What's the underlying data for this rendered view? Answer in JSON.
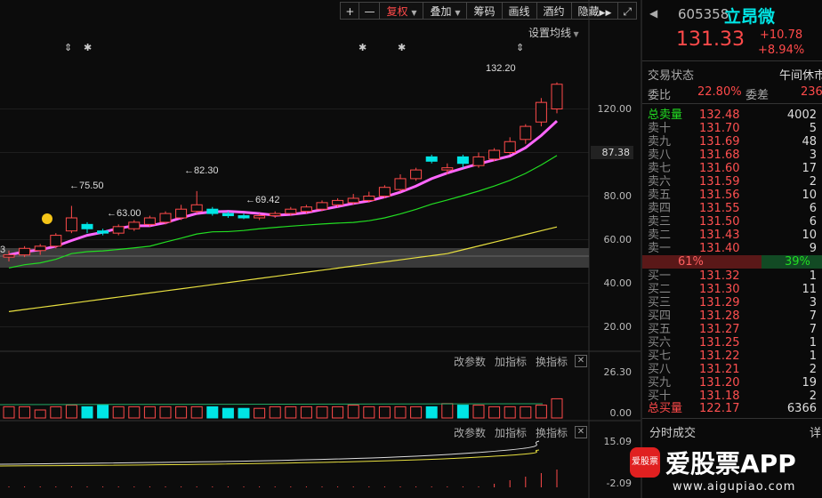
{
  "toolbar": {
    "plus": "+",
    "minus": "—",
    "restore": "复权",
    "overlay": "叠加",
    "chips": "筹码",
    "draw": "画线",
    "review": "酒约",
    "hide": "隐藏",
    "fullscreen_icon": "fullscreen-icon"
  },
  "chart": {
    "set_ma": "设置均线",
    "axis_labels": [
      "120.00",
      "100.00",
      "80.00",
      "60.00",
      "40.00",
      "20.00"
    ],
    "current_price_tag": "87.38",
    "annotations": {
      "high": "132.20",
      "a1": "75.50",
      "a2": "63.00",
      "a3": "82.30",
      "a4": "69.42",
      "left_cut": "3"
    },
    "sub1": {
      "params": "改参数",
      "add": "加指标",
      "switch": "换指标",
      "axis_top": "26.30",
      "axis_bottom": "0.00"
    },
    "sub2": {
      "params": "改参数",
      "add": "加指标",
      "switch": "换指标",
      "axis_top": "15.09",
      "axis_bottom": "-2.09"
    }
  },
  "chart_data": {
    "type": "candlestick",
    "ylim": [
      10,
      135
    ],
    "candles": [
      [
        52,
        53,
        50,
        55
      ],
      [
        53,
        56,
        52,
        57
      ],
      [
        55,
        57,
        53,
        58
      ],
      [
        57,
        62,
        56,
        63
      ],
      [
        64,
        70,
        63,
        75.5
      ],
      [
        67,
        65,
        63,
        68
      ],
      [
        64,
        63,
        62,
        65
      ],
      [
        63,
        66,
        62,
        67
      ],
      [
        65,
        68,
        64,
        69
      ],
      [
        67,
        70,
        66,
        71
      ],
      [
        68,
        72,
        67,
        73
      ],
      [
        70,
        74,
        69,
        76
      ],
      [
        73,
        76,
        72,
        82.3
      ],
      [
        74,
        72,
        71,
        75
      ],
      [
        72,
        71,
        70,
        73
      ],
      [
        71,
        70,
        69.42,
        72
      ],
      [
        70,
        71,
        69,
        72
      ],
      [
        71,
        72,
        70,
        73
      ],
      [
        72,
        74,
        71,
        75
      ],
      [
        73,
        75,
        72,
        76
      ],
      [
        74,
        77,
        73,
        78
      ],
      [
        76,
        78,
        75,
        79
      ],
      [
        77,
        79,
        76,
        81
      ],
      [
        78,
        80,
        77,
        82
      ],
      [
        80,
        84,
        79,
        85
      ],
      [
        83,
        88,
        82,
        90
      ],
      [
        88,
        92,
        87,
        93
      ],
      [
        98,
        96,
        95,
        99
      ],
      [
        92,
        93,
        90,
        95
      ],
      [
        98,
        95,
        93,
        99
      ],
      [
        94,
        98,
        93,
        100
      ],
      [
        97,
        101,
        96,
        102
      ],
      [
        100,
        105,
        99,
        107
      ],
      [
        106,
        112,
        104,
        113
      ],
      [
        114,
        123,
        112,
        125
      ],
      [
        120,
        131.33,
        118,
        132.2
      ]
    ],
    "volumes": [
      7,
      7,
      5,
      7,
      8,
      7,
      8,
      7,
      7,
      7,
      7,
      7,
      7,
      7,
      6,
      6,
      6,
      7,
      7,
      7,
      7,
      7,
      8,
      7,
      7,
      7,
      7,
      7,
      9,
      8,
      8,
      7,
      7,
      7,
      8,
      12
    ]
  },
  "panel": {
    "code": "605358",
    "name": "立昂微",
    "price": "131.33",
    "change": "+10.78",
    "pct": "+8.94%",
    "trade_status_label": "交易状态",
    "trade_status": "午间休市",
    "ratio_label": "委比",
    "ratio": "22.80%",
    "diff_label": "委差",
    "diff": "236",
    "total_sell_label": "总卖量",
    "total_sell_price": "132.48",
    "total_sell_vol": "4002",
    "sells": [
      {
        "label": "卖十",
        "price": "131.70",
        "vol": "5"
      },
      {
        "label": "卖九",
        "price": "131.69",
        "vol": "48"
      },
      {
        "label": "卖八",
        "price": "131.68",
        "vol": "3"
      },
      {
        "label": "卖七",
        "price": "131.60",
        "vol": "17"
      },
      {
        "label": "卖六",
        "price": "131.59",
        "vol": "2"
      },
      {
        "label": "卖五",
        "price": "131.56",
        "vol": "10"
      },
      {
        "label": "卖四",
        "price": "131.55",
        "vol": "6"
      },
      {
        "label": "卖三",
        "price": "131.50",
        "vol": "6"
      },
      {
        "label": "卖二",
        "price": "131.43",
        "vol": "10"
      },
      {
        "label": "卖一",
        "price": "131.40",
        "vol": "9"
      }
    ],
    "bar_left": "61%",
    "bar_right": "39%",
    "buys": [
      {
        "label": "买一",
        "price": "131.32",
        "vol": "1"
      },
      {
        "label": "买二",
        "price": "131.30",
        "vol": "11"
      },
      {
        "label": "买三",
        "price": "131.29",
        "vol": "3"
      },
      {
        "label": "买四",
        "price": "131.28",
        "vol": "7"
      },
      {
        "label": "买五",
        "price": "131.27",
        "vol": "7"
      },
      {
        "label": "买六",
        "price": "131.25",
        "vol": "1"
      },
      {
        "label": "买七",
        "price": "131.22",
        "vol": "1"
      },
      {
        "label": "买八",
        "price": "131.21",
        "vol": "2"
      },
      {
        "label": "买九",
        "price": "131.20",
        "vol": "19"
      },
      {
        "label": "买十",
        "price": "131.18",
        "vol": "2"
      }
    ],
    "total_buy_label": "总买量",
    "total_buy_price": "122.17",
    "total_buy_vol": "6366",
    "tick_label": "分时成交",
    "tick_right": "详"
  },
  "watermark": {
    "logo": "爱股票",
    "text": "爱股票APP",
    "url": "www.aigupiao.com"
  },
  "colors": {
    "up": "#ff4a4a",
    "down": "#00e5e5",
    "ma5": "#ff66ff",
    "ma10": "#22dd22",
    "ma20": "#e8e040"
  }
}
